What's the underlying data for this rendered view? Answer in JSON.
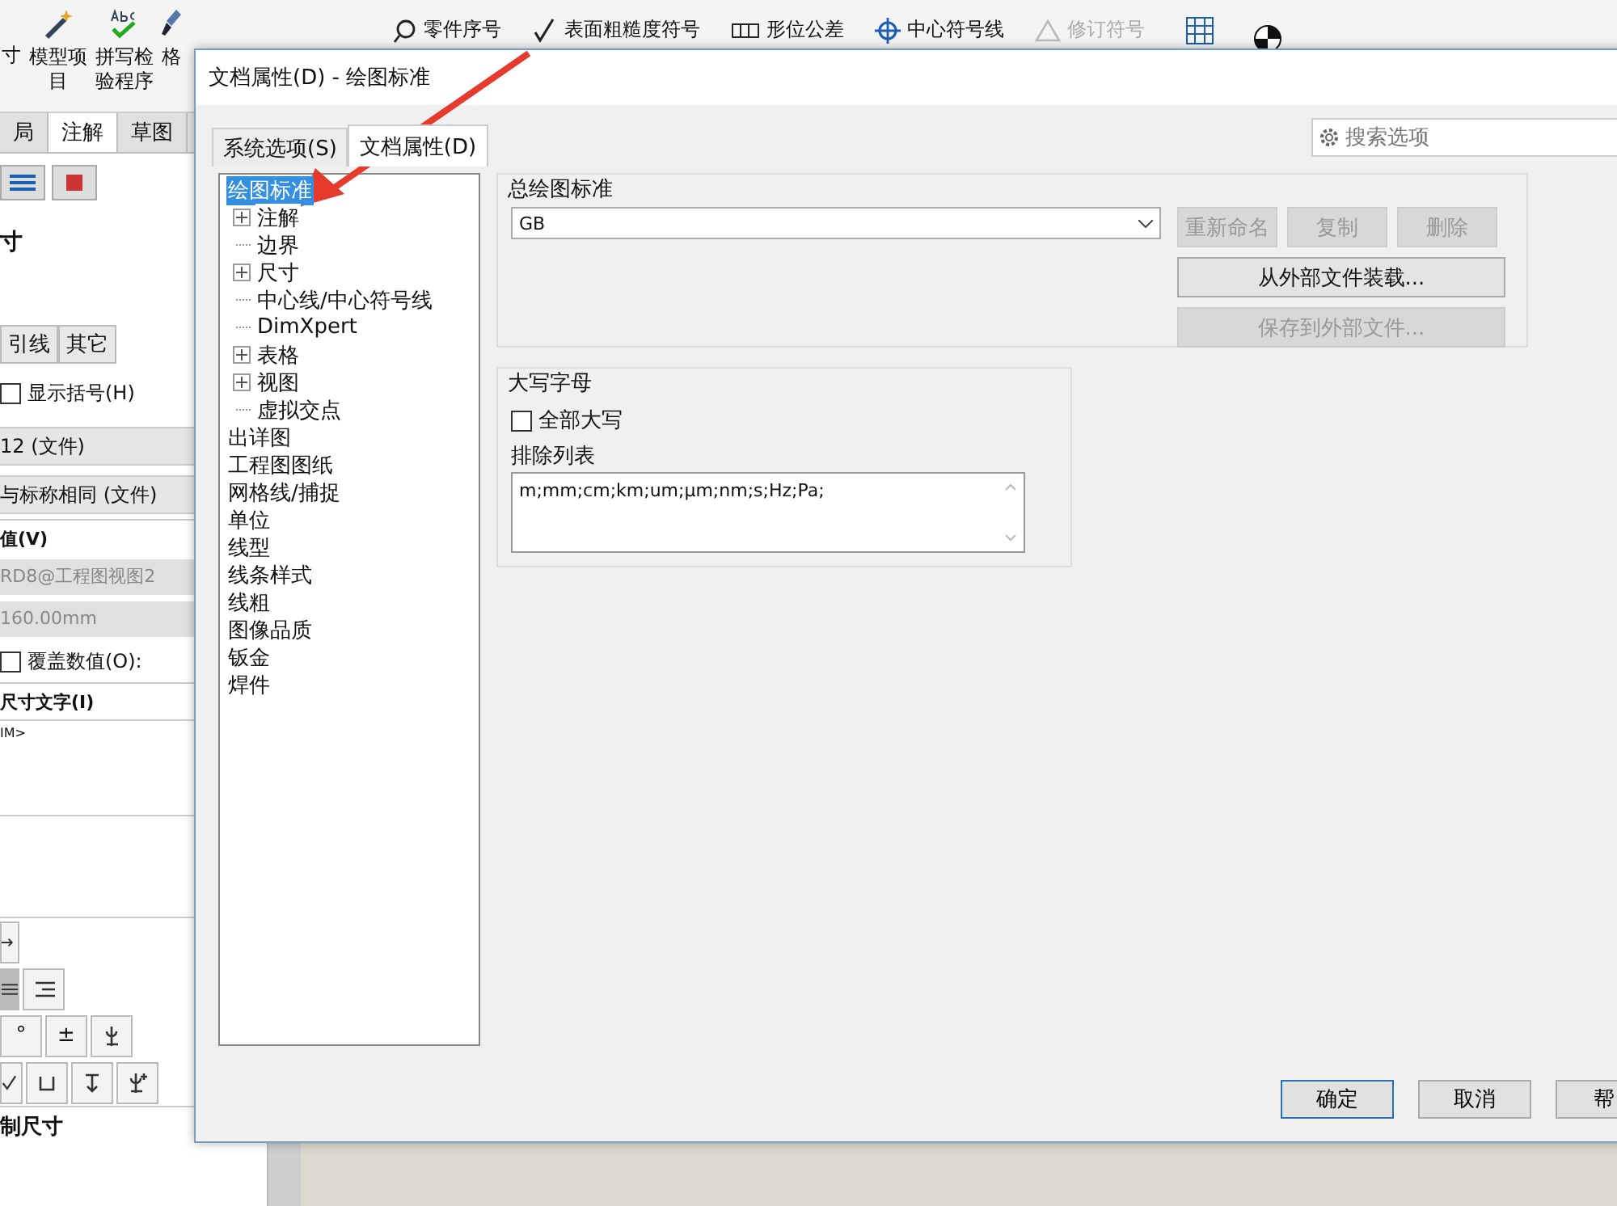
{
  "ribbon": {
    "items": [
      {
        "label": "寸",
        "kind": "cut"
      },
      {
        "label": "模型项目",
        "kind": "large"
      },
      {
        "label": "拼写检验程序",
        "kind": "large"
      },
      {
        "label": "格",
        "kind": "large"
      },
      {
        "label": "零件序号",
        "kind": "small",
        "disabled": false
      },
      {
        "label": "表面粗糙度符号",
        "kind": "small",
        "disabled": false
      },
      {
        "label": "形位公差",
        "kind": "small",
        "disabled": false
      },
      {
        "label": "中心符号线",
        "kind": "small",
        "disabled": false
      },
      {
        "label": "修订符号",
        "kind": "small",
        "disabled": true
      }
    ]
  },
  "panel": {
    "tabs": [
      {
        "label": "局",
        "selected": false
      },
      {
        "label": "注解",
        "selected": true
      },
      {
        "label": "草图",
        "selected": false
      }
    ],
    "title": "寸",
    "sub_tabs": [
      {
        "label": "引线",
        "selected": false
      },
      {
        "label": "其它",
        "selected": false
      }
    ],
    "show_brackets": {
      "label": "显示括号(H)",
      "checked": false
    },
    "dropdowns": [
      "12 (文件)",
      "与标称相同 (文件)"
    ],
    "value_label": "值(V)",
    "values": [
      "RD8@工程图视图2",
      "160.00mm"
    ],
    "override": {
      "label": "覆盖数值(O):",
      "checked": false
    },
    "text_label": "尺寸文字(I)",
    "text_value": "IM>",
    "symbols": [
      "°",
      "±"
    ],
    "bottom_section": "制尺寸"
  },
  "dialog": {
    "title": "文档属性(D) - 绘图标准",
    "tabs": [
      {
        "label": "系统选项(S)",
        "selected": false
      },
      {
        "label": "文档属性(D)",
        "selected": true
      }
    ],
    "search": {
      "placeholder": "搜索选项"
    },
    "tree": [
      {
        "label": "绘图标准",
        "selected": true,
        "children": [
          {
            "label": "注解",
            "selected": false,
            "kind": "collapsed"
          },
          {
            "label": "边界",
            "selected": false,
            "kind": "leaf"
          },
          {
            "label": "尺寸",
            "selected": false,
            "kind": "collapsed"
          },
          {
            "label": "中心线/中心符号线",
            "selected": false,
            "kind": "leaf"
          },
          {
            "label": "DimXpert",
            "selected": false,
            "kind": "leaf"
          },
          {
            "label": "表格",
            "selected": false,
            "kind": "collapsed"
          },
          {
            "label": "视图",
            "selected": false,
            "kind": "collapsed"
          },
          {
            "label": "虚拟交点",
            "selected": false,
            "kind": "leaf"
          }
        ]
      },
      {
        "label": "出详图",
        "selected": false
      },
      {
        "label": "工程图图纸",
        "selected": false
      },
      {
        "label": "网格线/捕捉",
        "selected": false
      },
      {
        "label": "单位",
        "selected": false
      },
      {
        "label": "线型",
        "selected": false
      },
      {
        "label": "线条样式",
        "selected": false
      },
      {
        "label": "线粗",
        "selected": false
      },
      {
        "label": "图像品质",
        "selected": false
      },
      {
        "label": "钣金",
        "selected": false
      },
      {
        "label": "焊件",
        "selected": false
      }
    ],
    "standard": {
      "title": "总绘图标准",
      "value": "GB",
      "buttons": [
        {
          "label": "重新命名",
          "disabled": true
        },
        {
          "label": "复制",
          "disabled": true
        },
        {
          "label": "删除",
          "disabled": true
        }
      ],
      "load": {
        "label": "从外部文件装载...",
        "disabled": false
      },
      "save": {
        "label": "保存到外部文件...",
        "disabled": true
      }
    },
    "uppercase": {
      "title": "大写字母",
      "all_caps": {
        "label": "全部大写",
        "checked": false
      },
      "exclude_label": "排除列表",
      "exclude_value": "m;mm;cm;km;um;µm;nm;s;Hz;Pa;"
    },
    "footer": [
      {
        "label": "确定",
        "default": true
      },
      {
        "label": "取消",
        "default": false
      },
      {
        "label": "帮",
        "default": false
      }
    ]
  }
}
